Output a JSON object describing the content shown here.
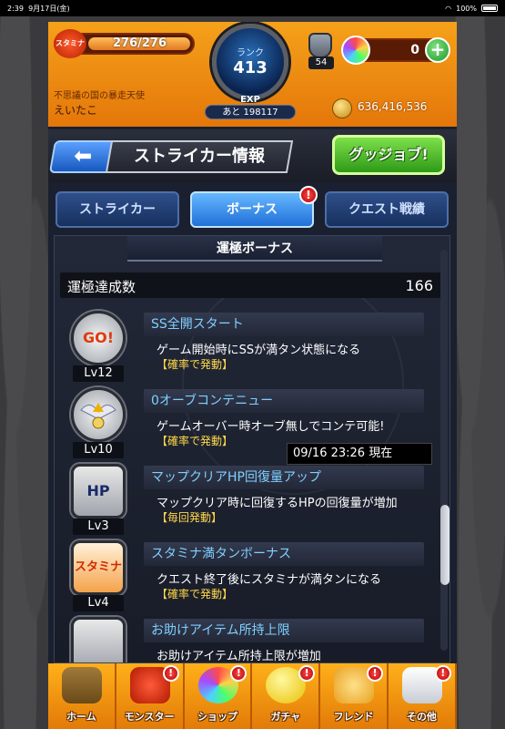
{
  "status_bar": {
    "time": "2:39",
    "date": "9月17日(金)",
    "battery": "100%"
  },
  "header": {
    "stamina_label": "スタミナ",
    "stamina": "276/276",
    "stamina_fraction": 1.0,
    "rank_label": "ランク",
    "rank": "413",
    "exp_label": "EXP",
    "exp_remaining": "あと 198117",
    "shield_count": "54",
    "orb_count": "0",
    "plus_label": "+",
    "player_title": "不思議の国の暴走天使",
    "player_name": "えいたこ",
    "coins": "636,416,536"
  },
  "titlebar": {
    "back_label": "⬅",
    "title": "ストライカー情報",
    "gugui_label": "グッジョブ!"
  },
  "tabs": [
    {
      "label": "ストライカー",
      "active": false
    },
    {
      "label": "ボーナス",
      "active": true,
      "badge": "!"
    },
    {
      "label": "クエスト戦績",
      "active": false
    }
  ],
  "panel": {
    "section_title": "運極ボーナス",
    "stat_label": "運極達成数",
    "stat_value": "166",
    "bonuses": [
      {
        "icon": "GO!",
        "level": "Lv12",
        "name": "SS全開スタート",
        "desc": "ゲーム開始時にSSが満タン状態になる",
        "note": "【確率で発動】"
      },
      {
        "icon": "",
        "level": "Lv10",
        "name": "0オーブコンテニュー",
        "desc": "ゲームオーバー時オーブ無しでコンテ可能!",
        "note": "【確率で発動】"
      },
      {
        "icon": "HP",
        "level": "Lv3",
        "name": "マップクリアHP回復量アップ",
        "desc": "マップクリア時に回復するHPの回復量が増加",
        "note": "【毎回発動】"
      },
      {
        "icon": "スタミナ",
        "level": "Lv4",
        "name": "スタミナ満タンボーナス",
        "desc": "クエスト終了後にスタミナが満タンになる",
        "note": "【確率で発動】"
      },
      {
        "icon": "",
        "level": "",
        "name": "お助けアイテム所持上限",
        "desc": "お助けアイテム所持上限が増加",
        "note": ""
      }
    ],
    "timestamp": "09/16 23:26 現在"
  },
  "nav": [
    {
      "label": "ホーム",
      "badge": ""
    },
    {
      "label": "モンスター",
      "badge": "!"
    },
    {
      "label": "ショップ",
      "badge": "!"
    },
    {
      "label": "ガチャ",
      "badge": "!"
    },
    {
      "label": "フレンド",
      "badge": "!"
    },
    {
      "label": "その他",
      "badge": "!"
    }
  ],
  "colors": {
    "accent": "#f5a11a",
    "tab_active": "#2070d8",
    "bonus_name": "#7fd0ff",
    "note": "#ffd84a"
  }
}
